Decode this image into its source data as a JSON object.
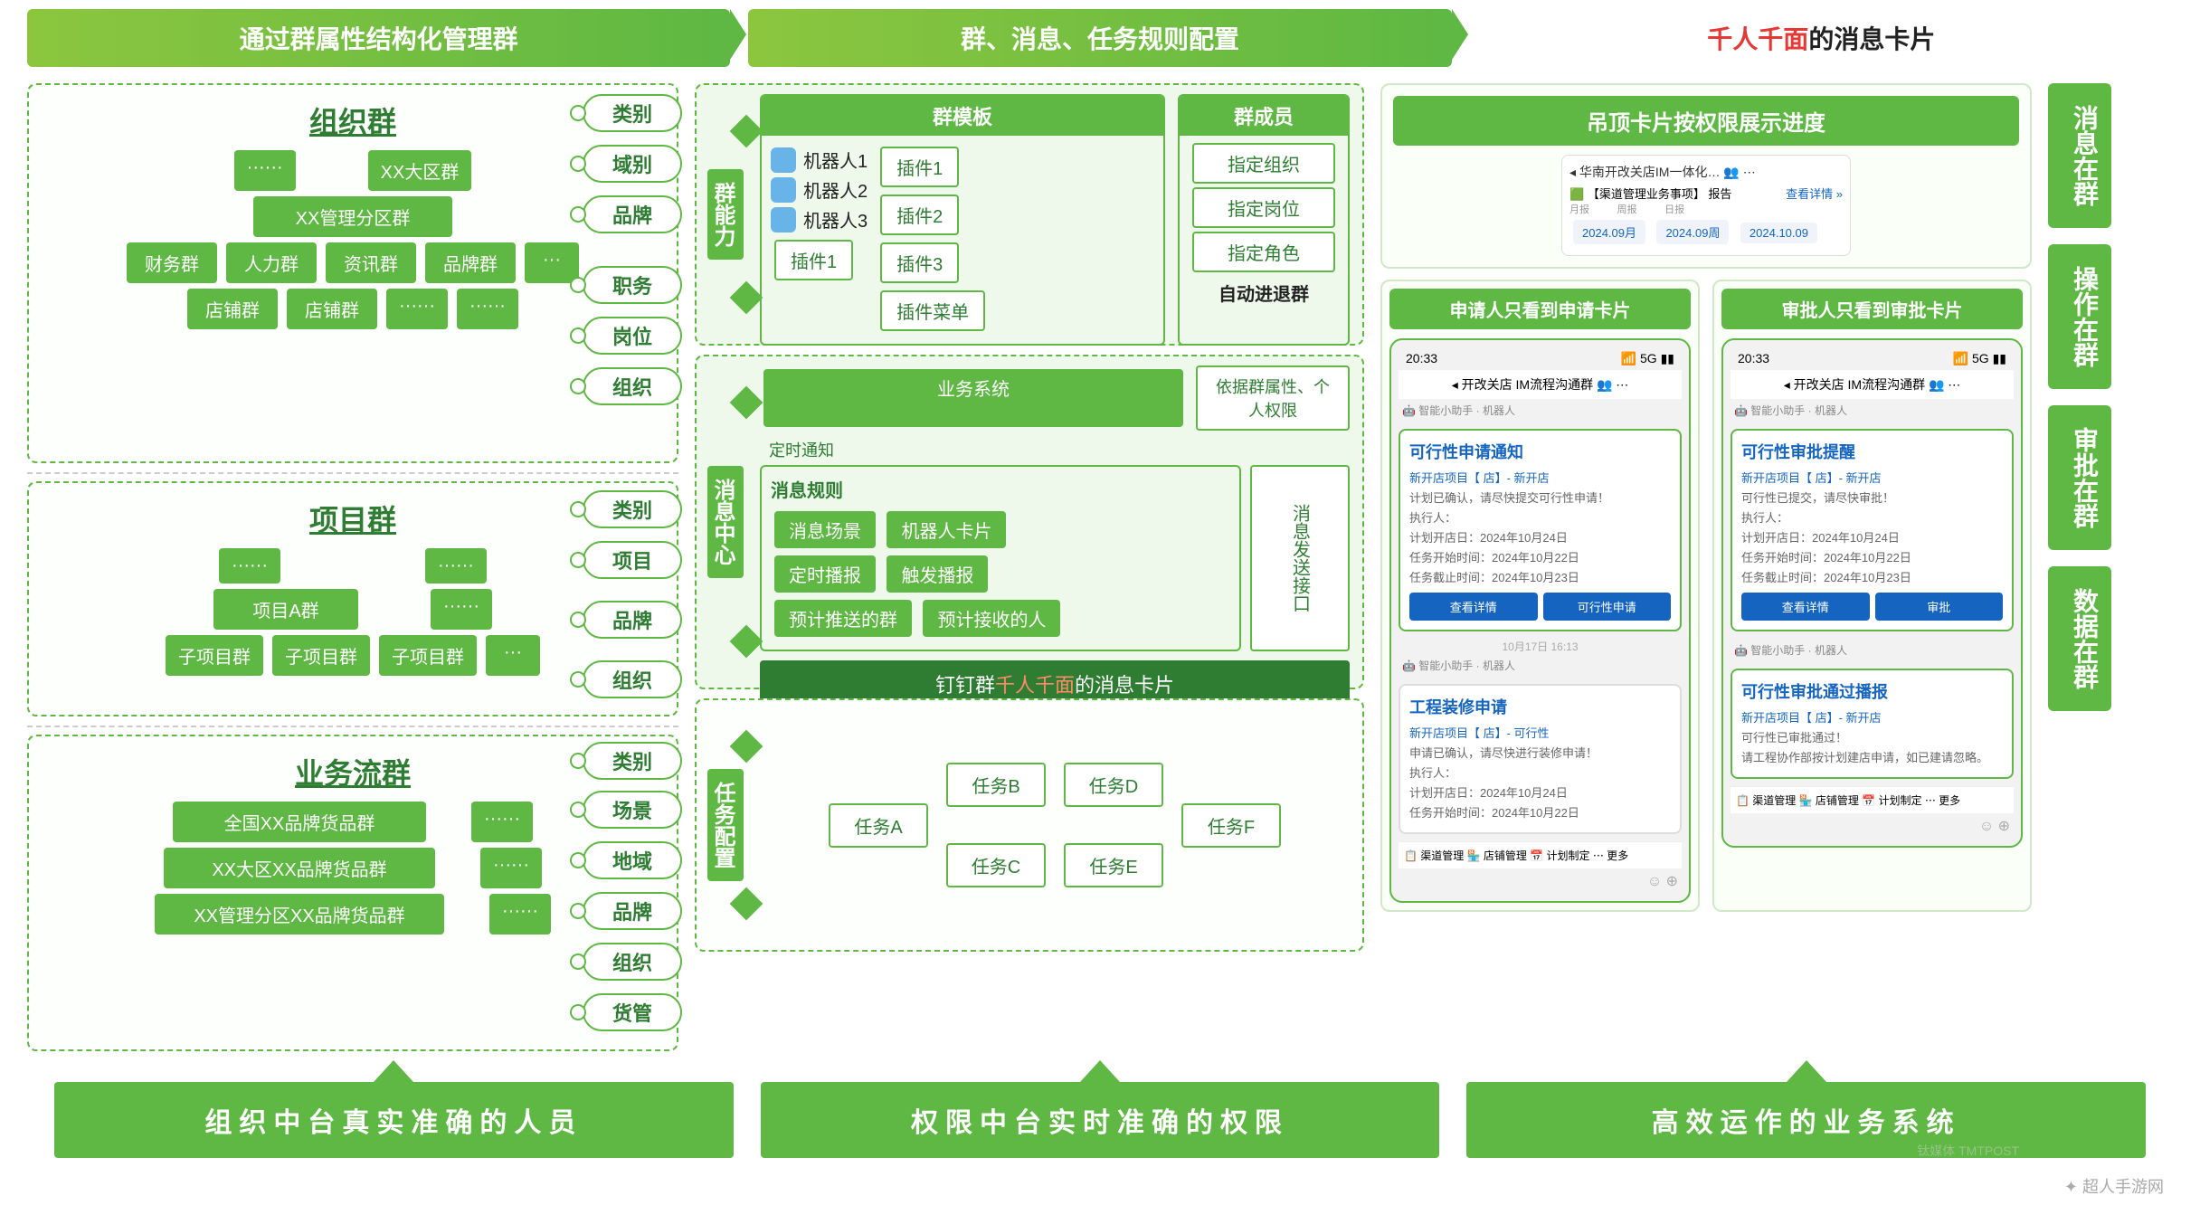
{
  "headers": {
    "h1": "通过群属性结构化管理群",
    "h2": "群、消息、任务规则配置",
    "h3a": "千人千面",
    "h3b": "的消息卡片"
  },
  "tags": {
    "t1": "类别",
    "t2": "域别",
    "t3": "品牌",
    "t4": "职务",
    "t5": "岗位",
    "t6": "组织",
    "t7": "类别",
    "t8": "项目",
    "t9": "品牌",
    "t10": "组织",
    "t11": "类别",
    "t12": "场景",
    "t13": "地域",
    "t14": "品牌",
    "t15": "组织",
    "t16": "货管"
  },
  "org": {
    "title": "组织群",
    "dots": "······",
    "n1": "XX大区群",
    "n2": "XX管理分区群",
    "r1": [
      "财务群",
      "人力群",
      "资讯群",
      "品牌群",
      "···"
    ],
    "r2": [
      "店铺群",
      "店铺群",
      "······",
      "······"
    ]
  },
  "proj": {
    "title": "项目群",
    "dots": "······",
    "n1": "项目A群",
    "r1": [
      "子项目群",
      "子项目群",
      "子项目群",
      "···"
    ]
  },
  "biz": {
    "title": "业务流群",
    "n1": "全国XX品牌货品群",
    "n2": "XX大区XX品牌货品群",
    "n3": "XX管理分区XX品牌货品群",
    "dots": "······"
  },
  "cap": {
    "label": "群能力",
    "templ": "群模板",
    "r1": "机器人1",
    "r2": "机器人2",
    "r3": "机器人3",
    "p1": "插件1",
    "p2": "插件2",
    "p3": "插件3",
    "pmenu": "插件菜单",
    "pa": "插件1",
    "mem": "群成员",
    "m1": "指定组织",
    "m2": "指定岗位",
    "m3": "指定角色",
    "m4": "自动进退群"
  },
  "msg": {
    "label": "消息中心",
    "sys": "业务系统",
    "dep": "依据群属性、个人权限",
    "timer": "定时通知",
    "rule": "消息规则",
    "sc": "消息场景",
    "rc": "机器人卡片",
    "tb": "定时播报",
    "trig": "触发播报",
    "pg": "预计推送的群",
    "pr": "预计接收的人",
    "send": "消息发送接口",
    "bar1": "钉钉群",
    "barRed": "千人千面",
    "bar2": "的消息卡片"
  },
  "task": {
    "label": "任务配置",
    "a": "任务A",
    "b": "任务B",
    "c": "任务C",
    "d": "任务D",
    "e": "任务E",
    "f": "任务F"
  },
  "ph": {
    "top": "吊顶卡片按权限展示进度",
    "topSub": "华南开改关店IM一体化…",
    "topChip": "【渠道管理业务事项】 报告",
    "topLink": "查看详情 »",
    "d1": "2024.09月",
    "d2": "2024.09周",
    "d3": "2024.10.09",
    "leftT": "申请人只看到申请卡片",
    "rightT": "审批人只看到审批卡片",
    "time": "20:33",
    "sig": "📶 5G ▮▮",
    "grp": "开改关店 IM流程沟通群",
    "bot": "智能小助手 · 机器人",
    "c1t": "可行性申请通知",
    "c1a": "新开店项目【                    店】- 新开店",
    "c1b": "计划已确认，请尽快提交可行性申请！",
    "exec": "执行人：",
    "l1": "计划开店日：2024年10月24日",
    "l2": "任务开始时间：2024年10月22日",
    "l3": "任务截止时间：2024年10月23日",
    "b1": "查看详情",
    "b2": "可行性申请",
    "ts": "10月17日 16:13",
    "c2t": "工程装修申请",
    "c2a": "新开店项目【                    店】- 可行性",
    "c2b": "申请已确认，请尽快进行装修申请！",
    "c3t": "可行性审批提醒",
    "c3a": "新开店项目【                    店】- 新开店",
    "c3b": "可行性已提交，请尽快审批！",
    "b3": "审批",
    "c4t": "可行性审批通过播报",
    "c4a": "新开店项目【                    店】- 新开店",
    "c4b": "可行性已审批通过！",
    "c4c": "请工程协作部按计划建店申请，如已建请忽略。",
    "tabs": "📋 渠道管理  🏪 店铺管理  📅 计划制定  ⋯ 更多"
  },
  "rbars": {
    "r1": "消息在群",
    "r2": "操作在群",
    "r3": "审批在群",
    "r4": "数据在群"
  },
  "bottom": {
    "b1": "组织中台真实准确的人员",
    "b2": "权限中台实时准确的权限",
    "b3": "高效运作的业务系统"
  },
  "wm": {
    "logo": "✦ 超人手游网",
    "tmt": "钛媒体 TMTPOST"
  }
}
